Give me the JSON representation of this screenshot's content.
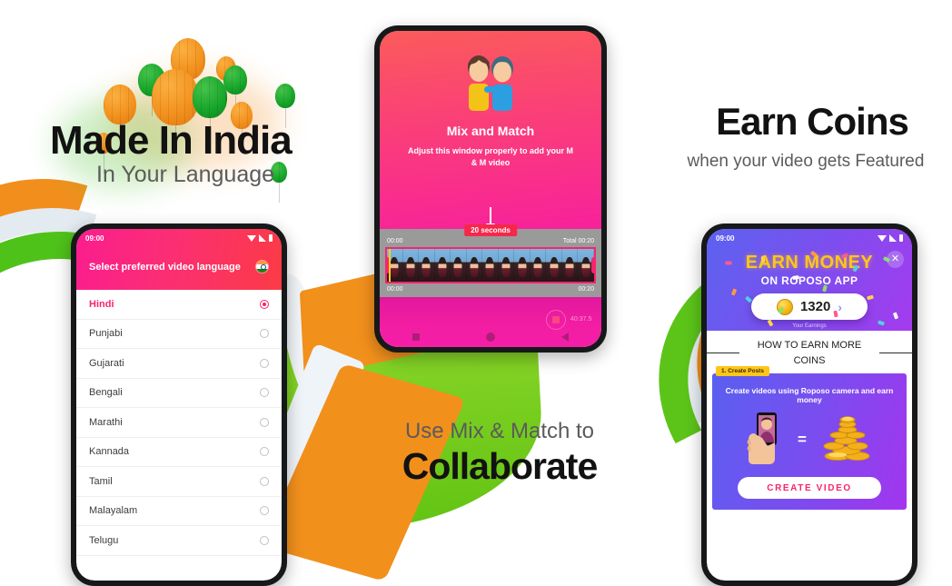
{
  "panels": {
    "left": {
      "title": "Made In India",
      "subtitle": "In Your Language"
    },
    "center": {
      "subtitle": "Use Mix & Match to",
      "title": "Collaborate"
    },
    "right": {
      "title": "Earn Coins",
      "subtitle": "when your video gets Featured"
    }
  },
  "phone_language": {
    "status_time": "09:00",
    "header_title": "Select preferred video language",
    "flag_icon": "india-flag-icon",
    "languages": [
      {
        "name": "Hindi",
        "selected": true
      },
      {
        "name": "Punjabi",
        "selected": false
      },
      {
        "name": "Gujarati",
        "selected": false
      },
      {
        "name": "Bengali",
        "selected": false
      },
      {
        "name": "Marathi",
        "selected": false
      },
      {
        "name": "Kannada",
        "selected": false
      },
      {
        "name": "Tamil",
        "selected": false
      },
      {
        "name": "Malayalam",
        "selected": false
      },
      {
        "name": "Telugu",
        "selected": false
      }
    ]
  },
  "phone_mixmatch": {
    "heading": "Mix and Match",
    "instruction": "Adjust this window properly to add your M & M video",
    "couple_icon": "couple-icon",
    "arrow_icon": "arrow-down-icon",
    "duration_badge": "20 seconds",
    "timeline": {
      "start_time": "00:00",
      "total_label": "Total 00:20",
      "bottom_start": "00:00",
      "bottom_end": "00:20"
    },
    "recorder_time": "40:37.5",
    "nav_icons": [
      "square-icon",
      "circle-icon",
      "back-triangle-icon"
    ]
  },
  "phone_earn": {
    "status_time": "09:00",
    "close_icon": "close-icon",
    "hero_title": "EARN MONEY",
    "hero_subtitle": "ON ROPOSO APP",
    "coin_icon": "coin-icon",
    "coin_balance": "1320",
    "chevron_icon": "chevron-right-icon",
    "earnings_label": "Your Earnings",
    "how_heading": "HOW TO EARN MORE COINS",
    "card_badge": "1. Create Posts",
    "card_description": "Create videos using Roposo camera and earn money",
    "phone_hand_icon": "phone-in-hand-icon",
    "equals_symbol": "=",
    "coins_stack_icon": "coin-stack-icon",
    "cta_label": "CREATE VIDEO"
  },
  "colors": {
    "pink": "#F8246E",
    "magenta": "#F21DA2",
    "purple": "#7B4FEF",
    "gold": "#FFC61A",
    "saffron": "#F2901C",
    "green": "#5CC419"
  }
}
